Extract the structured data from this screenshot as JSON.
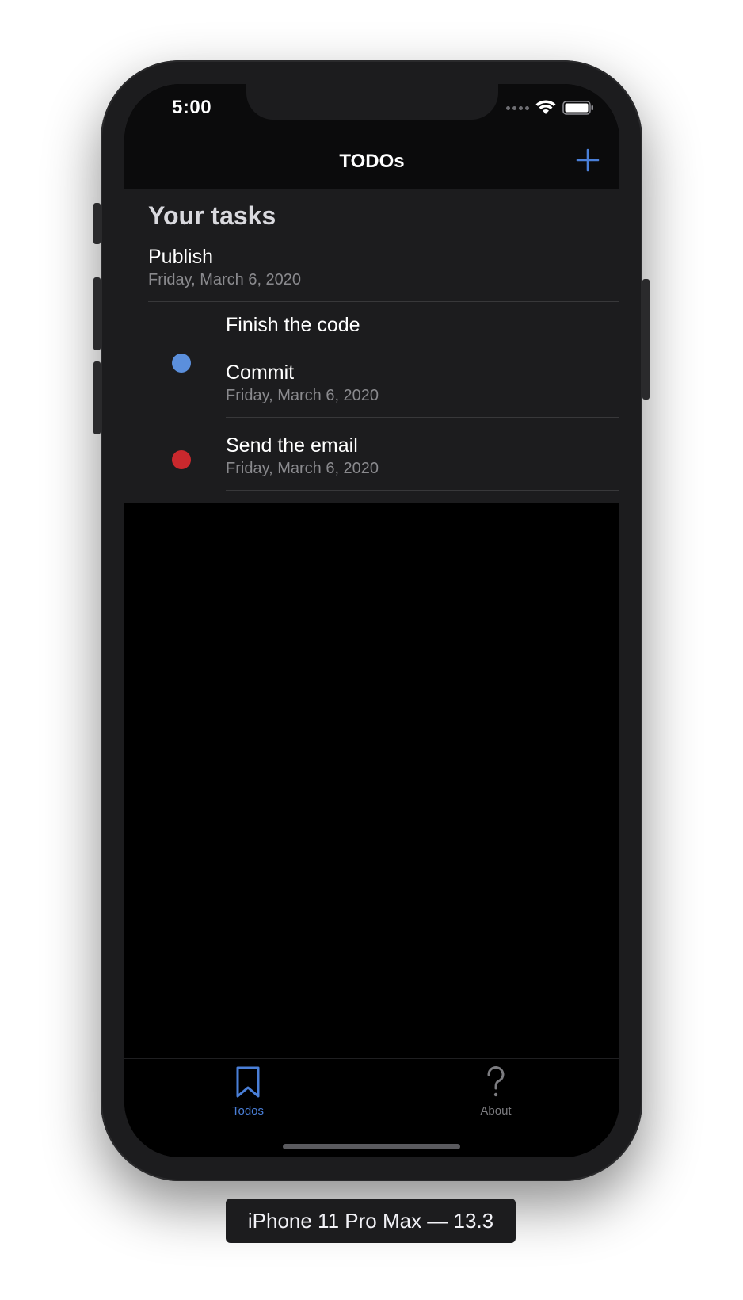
{
  "status_bar": {
    "time": "5:00"
  },
  "nav": {
    "title": "TODOs",
    "add_icon": "plus-icon"
  },
  "list": {
    "header": "Your tasks",
    "items": [
      {
        "title": "Publish",
        "date": "Friday, March 6, 2020"
      },
      {
        "title": "Finish the code",
        "subtitle": "Commit",
        "date": "Friday, March 6, 2020",
        "dot_color": "#5b8fdc"
      },
      {
        "title": "Send the email",
        "date": "Friday, March 6, 2020",
        "dot_color": "#c9282d"
      }
    ]
  },
  "tabs": [
    {
      "label": "Todos",
      "icon": "bookmark-icon",
      "selected": true
    },
    {
      "label": "About",
      "icon": "question-mark-icon",
      "selected": false
    }
  ],
  "colors": {
    "accent": "#4a7fd8",
    "inactive_tab": "#7c7c80",
    "blue_dot": "#5b8fdc",
    "red_dot": "#c9282d"
  },
  "device_label": "iPhone 11 Pro Max — 13.3"
}
